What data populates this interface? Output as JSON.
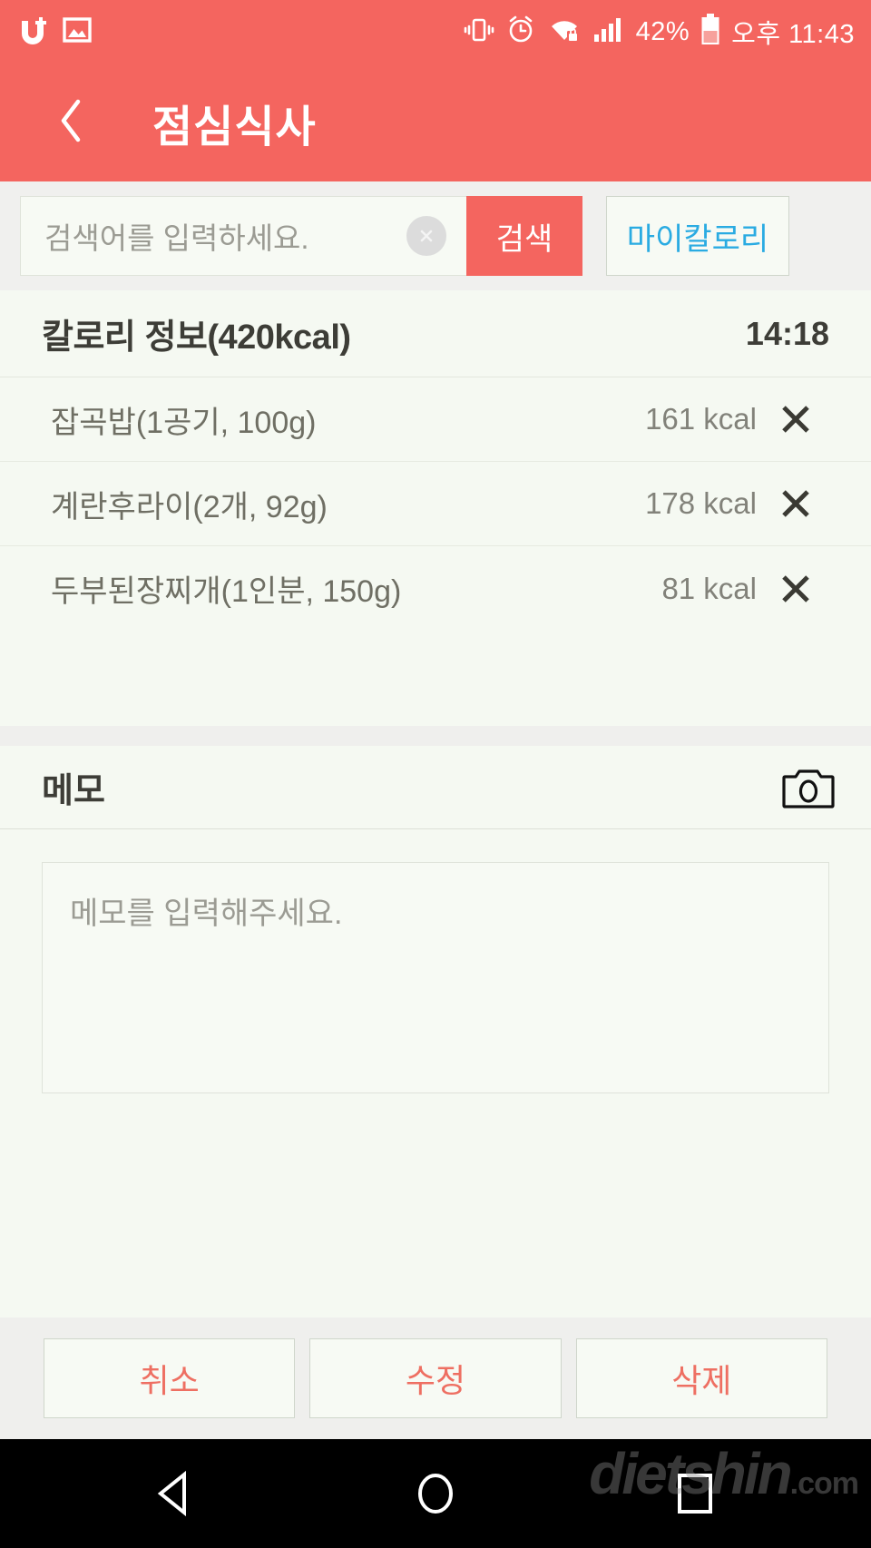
{
  "status_bar": {
    "notification_icons": [
      "uplus-logo-icon",
      "gallery-image-icon"
    ],
    "vibrate_icon": "vibrate-icon",
    "alarm_icon": "alarm-clock-icon",
    "wifi_icon": "wifi-locked-icon",
    "signal_icon": "cellular-signal-icon",
    "battery_percent": "42%",
    "battery_icon": "battery-icon",
    "time": "오후 11:43"
  },
  "appbar": {
    "back_icon": "chevron-left-icon",
    "title": "점심식사"
  },
  "search": {
    "placeholder": "검색어를 입력하세요.",
    "value": "",
    "clear_icon": "clear-circle-icon",
    "search_button": "검색",
    "mycalorie_button": "마이칼로리"
  },
  "calorie_section": {
    "title": "칼로리 정보(420kcal)",
    "total_kcal": 420,
    "time": "14:18",
    "items": [
      {
        "name": "잡곡밥(1공기, 100g)",
        "kcal": "161 kcal",
        "delete_icon": "close-x-icon"
      },
      {
        "name": "계란후라이(2개, 92g)",
        "kcal": "178 kcal",
        "delete_icon": "close-x-icon"
      },
      {
        "name": "두부된장찌개(1인분, 150g)",
        "kcal": "81 kcal",
        "delete_icon": "close-x-icon"
      }
    ]
  },
  "memo_section": {
    "title": "메모",
    "camera_icon": "camera-icon",
    "placeholder": "메모를 입력해주세요.",
    "value": ""
  },
  "footer": {
    "cancel": "취소",
    "edit": "수정",
    "delete": "삭제"
  },
  "navbar": {
    "back_icon": "nav-back-triangle-icon",
    "home_icon": "nav-home-circle-icon",
    "recents_icon": "nav-recents-square-icon"
  },
  "watermark": {
    "text": "dietshin",
    "suffix": ".com"
  },
  "colors": {
    "accent_coral": "#f4655f",
    "button_text_coral": "#ee6f62",
    "link_blue": "#2aabe2",
    "page_bg": "#f5f9f2",
    "band_gray": "#efefed"
  }
}
